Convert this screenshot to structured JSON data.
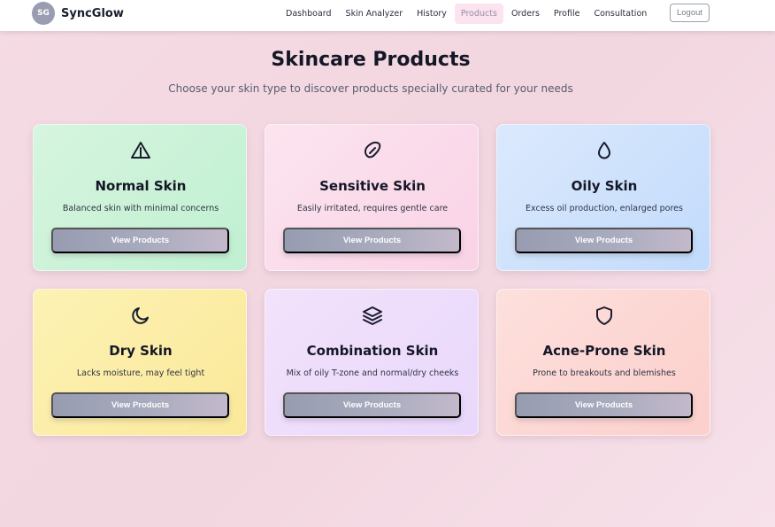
{
  "brand": {
    "initials": "SG",
    "name": "SyncGlow"
  },
  "nav": {
    "links": [
      {
        "label": "Dashboard"
      },
      {
        "label": "Skin Analyzer"
      },
      {
        "label": "History"
      },
      {
        "label": "Products",
        "active": true
      },
      {
        "label": "Orders"
      },
      {
        "label": "Profile"
      },
      {
        "label": "Consultation"
      }
    ],
    "logout_label": "Logout"
  },
  "page": {
    "title": "Skincare Products",
    "subtitle": "Choose your skin type to discover products specially curated for your needs"
  },
  "cards": [
    {
      "title": "Normal Skin",
      "description": "Balanced skin with minimal concerns",
      "button": "View Products",
      "icon": "warning-triangle-icon",
      "color": "#c8f2d7"
    },
    {
      "title": "Sensitive Skin",
      "description": "Easily irritated, requires gentle care",
      "button": "View Products",
      "icon": "pill-icon",
      "color": "#fad9e9"
    },
    {
      "title": "Oily Skin",
      "description": "Excess oil production, enlarged pores",
      "button": "View Products",
      "icon": "droplet-icon",
      "color": "#cde1fc"
    },
    {
      "title": "Dry Skin",
      "description": "Lacks moisture, may feel tight",
      "button": "View Products",
      "icon": "moon-icon",
      "color": "#fbeda6"
    },
    {
      "title": "Combination Skin",
      "description": "Mix of oily T-zone and normal/dry cheeks",
      "button": "View Products",
      "icon": "layers-icon",
      "color": "#ecdcfb"
    },
    {
      "title": "Acne-Prone Skin",
      "description": "Prone to breakouts and blemishes",
      "button": "View Products",
      "icon": "shield-icon",
      "color": "#fcd6d2"
    }
  ],
  "colors": {
    "accent_active_nav": "#fbe3ef",
    "button_gradient_start": "#979cb0",
    "button_gradient_end": "#c3b9cb",
    "background": "#f4d9e3"
  }
}
